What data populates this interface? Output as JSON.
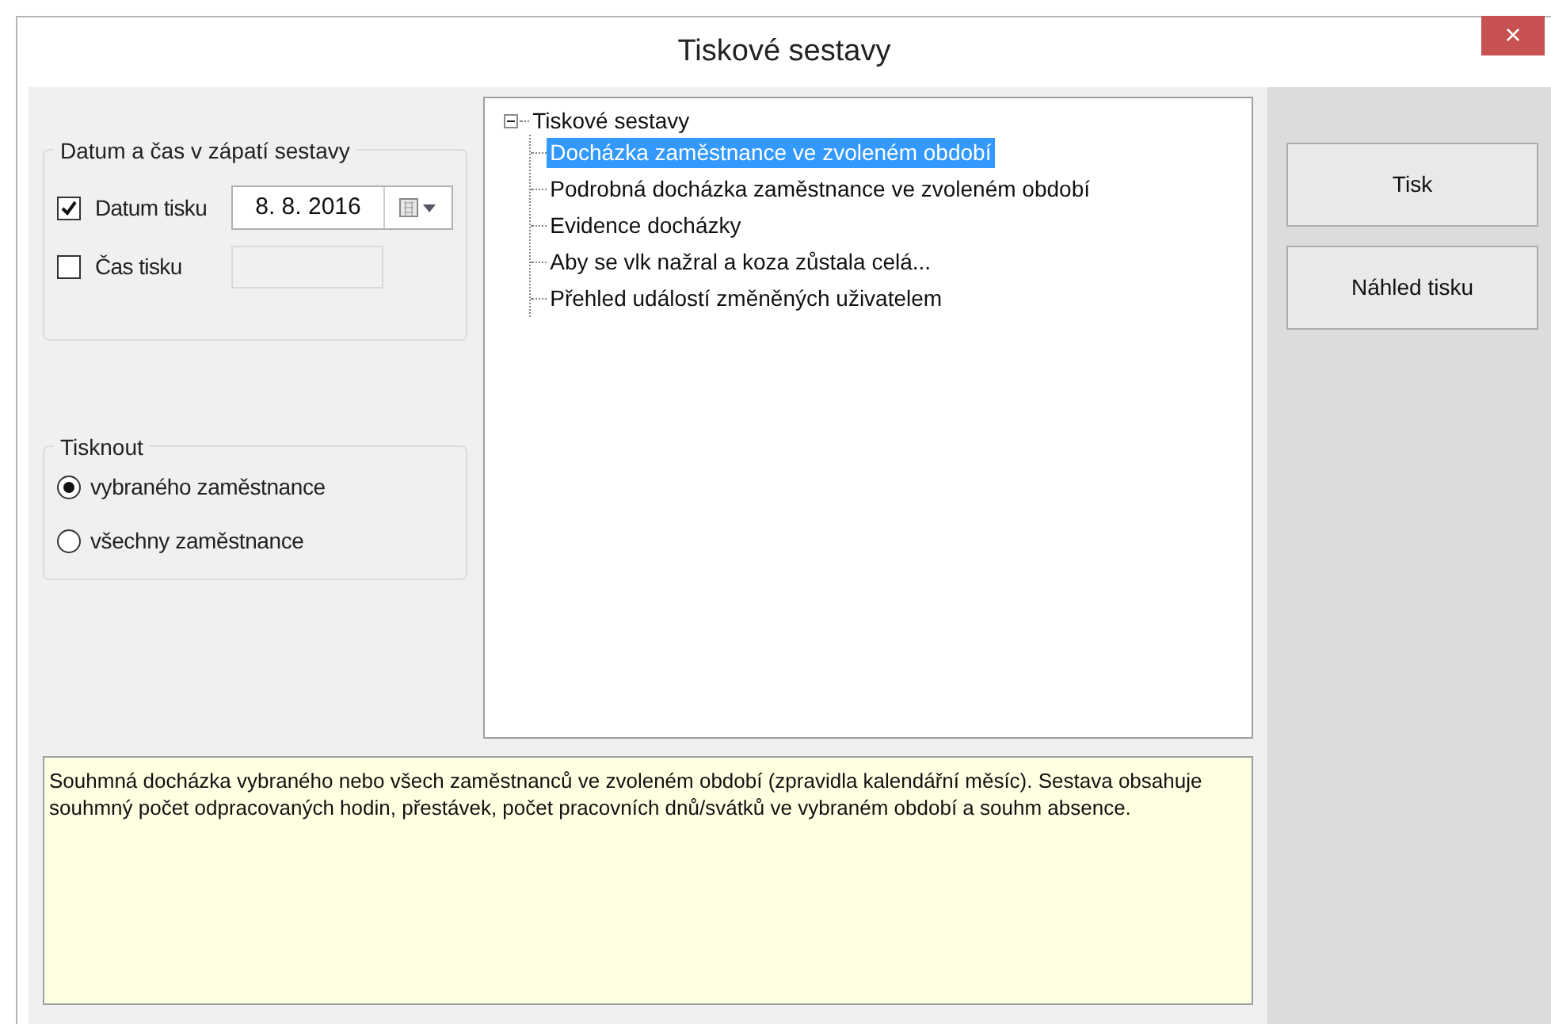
{
  "window": {
    "title": "Tiskové sestavy",
    "close": "×"
  },
  "footer_group": {
    "title": "Datum a čas v zápatí sestavy",
    "rows": [
      {
        "kind": "date",
        "label": "Datum tisku",
        "checked": true,
        "value": "8. 8. 2016",
        "disabled": false
      },
      {
        "kind": "time",
        "label": "Čas tisku",
        "checked": false,
        "disabled": true
      }
    ]
  },
  "print_group": {
    "title": "Tisknout",
    "options": [
      {
        "label": "vybraného zaměstnance",
        "selected": true
      },
      {
        "label": "všechny zaměstnance",
        "selected": false
      }
    ]
  },
  "tree": {
    "label": "Tiskové sestavy",
    "expanded": true,
    "children": [
      {
        "label": "Docházka zaměstnance ve zvoleném období",
        "selected": true
      },
      {
        "label": "Podrobná docházka zaměstnance ve zvoleném období",
        "selected": false
      },
      {
        "label": "Evidence docházky",
        "selected": false
      },
      {
        "label": "Aby se vlk nažral a koza zůstala celá...",
        "selected": false
      },
      {
        "label": "Přehled událostí změněných uživatelem",
        "selected": false
      }
    ]
  },
  "description": "Souhmná docházka vybraného nebo všech zaměstnanců ve zvoleném období (zpravidla kalendářní měsíc). Sestava obsahuje souhmný počet odpracovaných hodin, přestávek, počet pracovních dnů/svátků ve vybraném období a souhm absence.",
  "buttons": [
    "Tisk",
    "Náhled tisku"
  ]
}
